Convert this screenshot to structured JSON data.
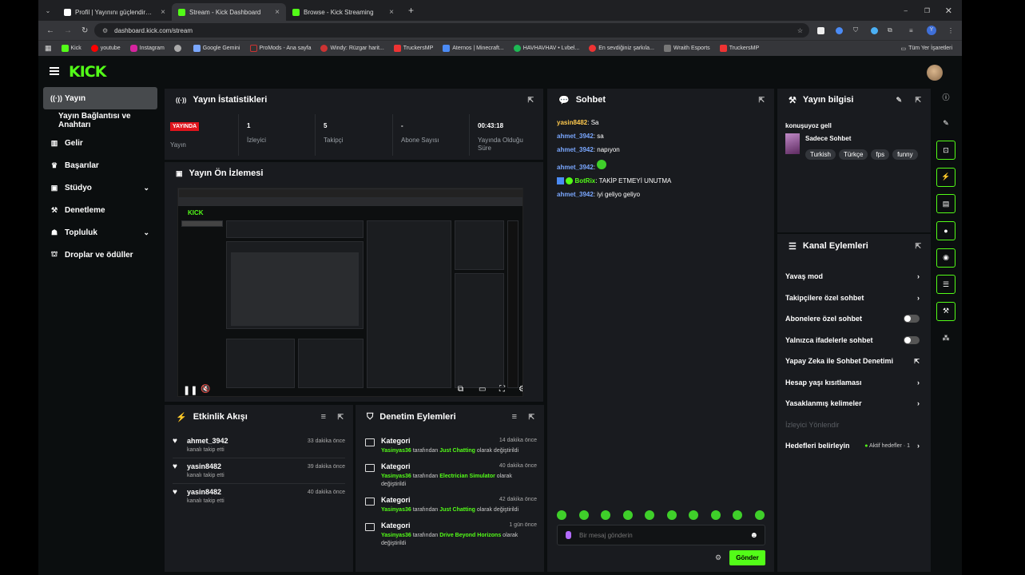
{
  "browser": {
    "tabs": [
      {
        "title": "Profil | Yayınını güçlendirmek içi",
        "active": false
      },
      {
        "title": "Stream - Kick Dashboard",
        "active": true
      },
      {
        "title": "Browse - Kick Streaming",
        "active": false
      }
    ],
    "url": "dashboard.kick.com/stream",
    "bookmarks": [
      "Kick",
      "youtube",
      "Instagram",
      "",
      "Google Gemini",
      "ProMods - Ana sayfa",
      "Windy: Rüzgar harit...",
      "TruckersMP",
      "Aternos | Minecraft...",
      "HAVHAVHAV • Lvbel...",
      "En sevdiğiniz şarkıla...",
      "Wraith Esports",
      "TruckersMP"
    ],
    "all_bookmarks": "Tüm Yer İşaretleri"
  },
  "app": {
    "logo": "KICK",
    "brand_color": "#53fc18"
  },
  "sidebar": {
    "items": [
      {
        "label": "Yayın",
        "icon": "broadcast-icon"
      },
      {
        "label": "Yayın Bağlantısı ve Anahtarı",
        "icon": ""
      },
      {
        "label": "Gelir",
        "icon": "revenue-icon"
      },
      {
        "label": "Başarılar",
        "icon": "trophy-icon"
      },
      {
        "label": "Stüdyo",
        "icon": "studio-icon"
      },
      {
        "label": "Denetleme",
        "icon": "wrench-icon"
      },
      {
        "label": "Topluluk",
        "icon": "community-icon"
      },
      {
        "label": "Droplar ve ödüller",
        "icon": "gift-icon"
      }
    ]
  },
  "stats": {
    "title": "Yayın İstatistikleri",
    "live_badge": "YAYINDA",
    "items": [
      {
        "value": "",
        "label": "Yayın"
      },
      {
        "value": "1",
        "label": "İzleyici"
      },
      {
        "value": "5",
        "label": "Takipçi"
      },
      {
        "value": "-",
        "label": "Abone Sayısı"
      },
      {
        "value": "00:43:18",
        "label": "Yayında Olduğu Süre"
      }
    ]
  },
  "preview": {
    "title": "Yayın Ön İzlemesi"
  },
  "activity": {
    "title": "Etkinlik Akışı",
    "items": [
      {
        "user": "ahmet_3942",
        "text": "kanalı takip etti",
        "time": "33 dakika önce"
      },
      {
        "user": "yasin8482",
        "text": "kanalı takip etti",
        "time": "39 dakika önce"
      },
      {
        "user": "yasin8482",
        "text": "kanalı takip etti",
        "time": "40 dakika önce"
      }
    ]
  },
  "moderation": {
    "title": "Denetim Eylemleri",
    "by": "tarafından",
    "as": "olarak",
    "changed": "değiştirildi",
    "items": [
      {
        "name": "Kategori",
        "user": "Yasinyas36",
        "category": "Just Chatting",
        "time": "14 dakika önce"
      },
      {
        "name": "Kategori",
        "user": "Yasinyas36",
        "category": "Electrician Simulator",
        "time": "40 dakika önce"
      },
      {
        "name": "Kategori",
        "user": "Yasinyas36",
        "category": "Just Chatting",
        "time": "42 dakika önce"
      },
      {
        "name": "Kategori",
        "user": "Yasinyas36",
        "category": "Drive Beyond Horizons",
        "time": "1 gün önce"
      }
    ]
  },
  "chat": {
    "title": "Sohbet",
    "messages": [
      {
        "user": "yasin8482",
        "text": "Sa",
        "color": "#ffc94d"
      },
      {
        "user": "ahmet_3942",
        "text": "sa",
        "color": "#7aa7ff"
      },
      {
        "user": "ahmet_3942",
        "text": "napıyon",
        "color": "#7aa7ff"
      },
      {
        "user": "ahmet_3942",
        "text": "",
        "color": "#7aa7ff"
      },
      {
        "user": "BotRix",
        "text": "TAKİP ETMEYİ UNUTMA",
        "color": "#53fc18"
      },
      {
        "user": "ahmet_3942",
        "text": "iyi geliyo geliyo",
        "color": "#7aa7ff"
      }
    ],
    "placeholder": "Bir mesaj gönderin",
    "send": "Gönder"
  },
  "stream_info": {
    "title": "Yayın bilgisi",
    "stream_title": "konuşuyoz gell",
    "category": "Sadece Sohbet",
    "tags": [
      "Turkish",
      "Türkçe",
      "fps",
      "funny"
    ]
  },
  "channel_actions": {
    "title": "Kanal Eylemleri",
    "items": [
      {
        "label": "Yavaş mod",
        "control": "chevron"
      },
      {
        "label": "Takipçilere özel sohbet",
        "control": "chevron"
      },
      {
        "label": "Abonelere özel sohbet",
        "control": "toggle"
      },
      {
        "label": "Yalnızca ifadelerle sohbet",
        "control": "toggle"
      },
      {
        "label": "Yapay Zeka ile Sohbet Denetimi",
        "control": "external"
      },
      {
        "label": "Hesap yaşı kısıtlaması",
        "control": "chevron"
      },
      {
        "label": "Yasaklanmış kelimeler",
        "control": "chevron"
      },
      {
        "label": "İzleyici Yönlendir",
        "control": "none",
        "disabled": true
      },
      {
        "label": "Hedefleri belirleyin",
        "control": "chevron",
        "badge": "Aktif hedefler · 1"
      }
    ]
  }
}
